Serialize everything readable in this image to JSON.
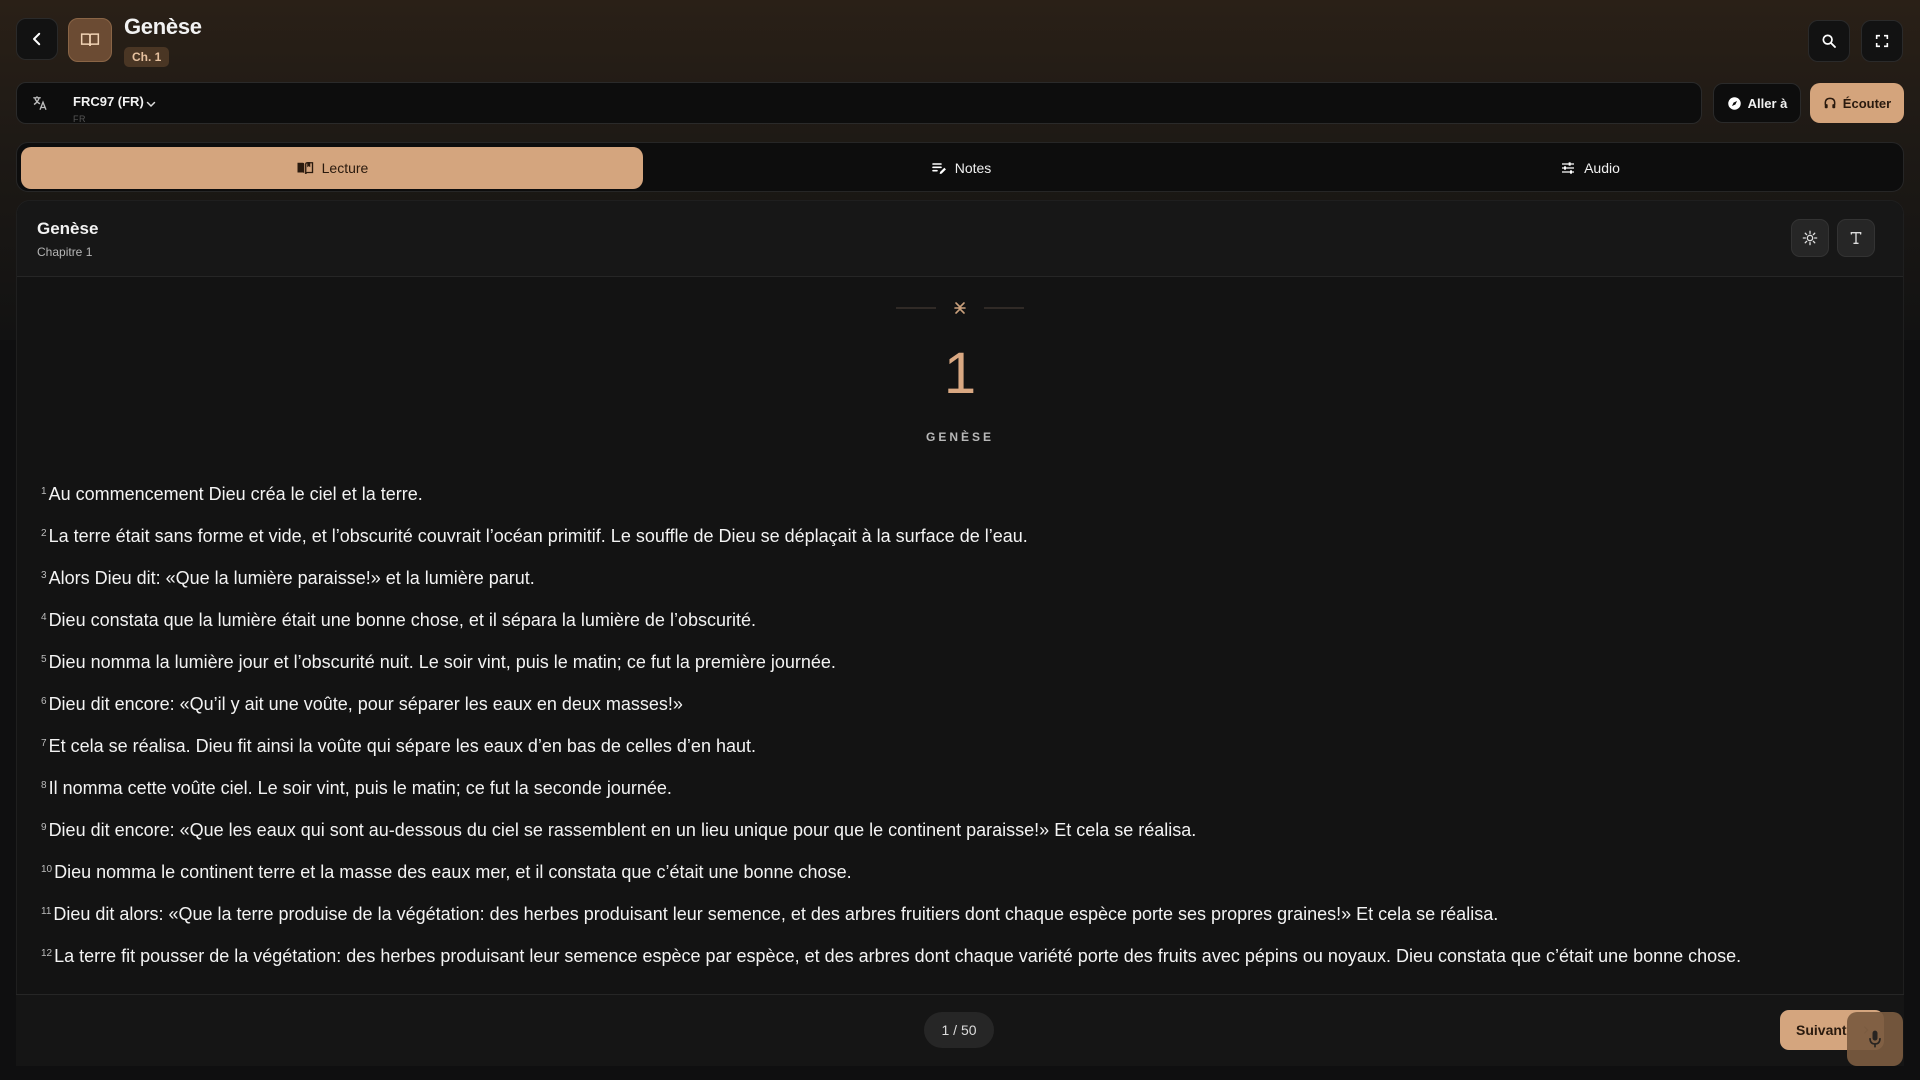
{
  "header": {
    "title": "Genèse",
    "chapter_badge": "Ch. 1"
  },
  "version": {
    "name": "FRC97 (FR)",
    "sub": "FR"
  },
  "actions": {
    "goto_label": "Aller à",
    "listen_label": "Écouter"
  },
  "tabs": [
    {
      "label": "Lecture",
      "active": true
    },
    {
      "label": "Notes",
      "active": false
    },
    {
      "label": "Audio",
      "active": false
    }
  ],
  "reader": {
    "book": "Genèse",
    "chapter_label": "Chapitre 1",
    "chapter_number": "1",
    "book_caps": "GENÈSE",
    "verses": [
      {
        "n": "1",
        "text": "Au commencement Dieu créa le ciel et la terre."
      },
      {
        "n": "2",
        "text": "La terre était sans forme et vide, et l’obscurité couvrait l’océan primitif. Le souffle de Dieu se déplaçait à la surface de l’eau."
      },
      {
        "n": "3",
        "text": "Alors Dieu dit: «Que la lumière paraisse!» et la lumière parut."
      },
      {
        "n": "4",
        "text": "Dieu constata que la lumière était une bonne chose, et il sépara la lumière de l’obscurité."
      },
      {
        "n": "5",
        "text": "Dieu nomma la lumière jour et l’obscurité nuit. Le soir vint, puis le matin; ce fut la première journée."
      },
      {
        "n": "6",
        "text": "Dieu dit encore: «Qu’il y ait une voûte, pour séparer les eaux en deux masses!»"
      },
      {
        "n": "7",
        "text": "Et cela se réalisa. Dieu fit ainsi la voûte qui sépare les eaux d’en bas de celles d’en haut."
      },
      {
        "n": "8",
        "text": "Il nomma cette voûte ciel. Le soir vint, puis le matin; ce fut la seconde journée."
      },
      {
        "n": "9",
        "text": "Dieu dit encore: «Que les eaux qui sont au-dessous du ciel se rassemblent en un lieu unique pour que le continent paraisse!» Et cela se réalisa."
      },
      {
        "n": "10",
        "text": "Dieu nomma le continent terre et la masse des eaux mer, et il constata que c’était une bonne chose."
      },
      {
        "n": "11",
        "text": "Dieu dit alors: «Que la terre produise de la végétation: des herbes produisant leur semence, et des arbres fruitiers dont chaque espèce porte ses propres graines!» Et cela se réalisa."
      },
      {
        "n": "12",
        "text": "La terre fit pousser de la végétation: des herbes produisant leur semence espèce par espèce, et des arbres dont chaque variété porte des fruits avec pépins ou noyaux. Dieu constata que c’était une bonne chose."
      }
    ]
  },
  "footer": {
    "page_indicator": "1 / 50",
    "next_label": "Suivant"
  },
  "colors": {
    "accent": "#d4a57e",
    "background": "#131313"
  }
}
